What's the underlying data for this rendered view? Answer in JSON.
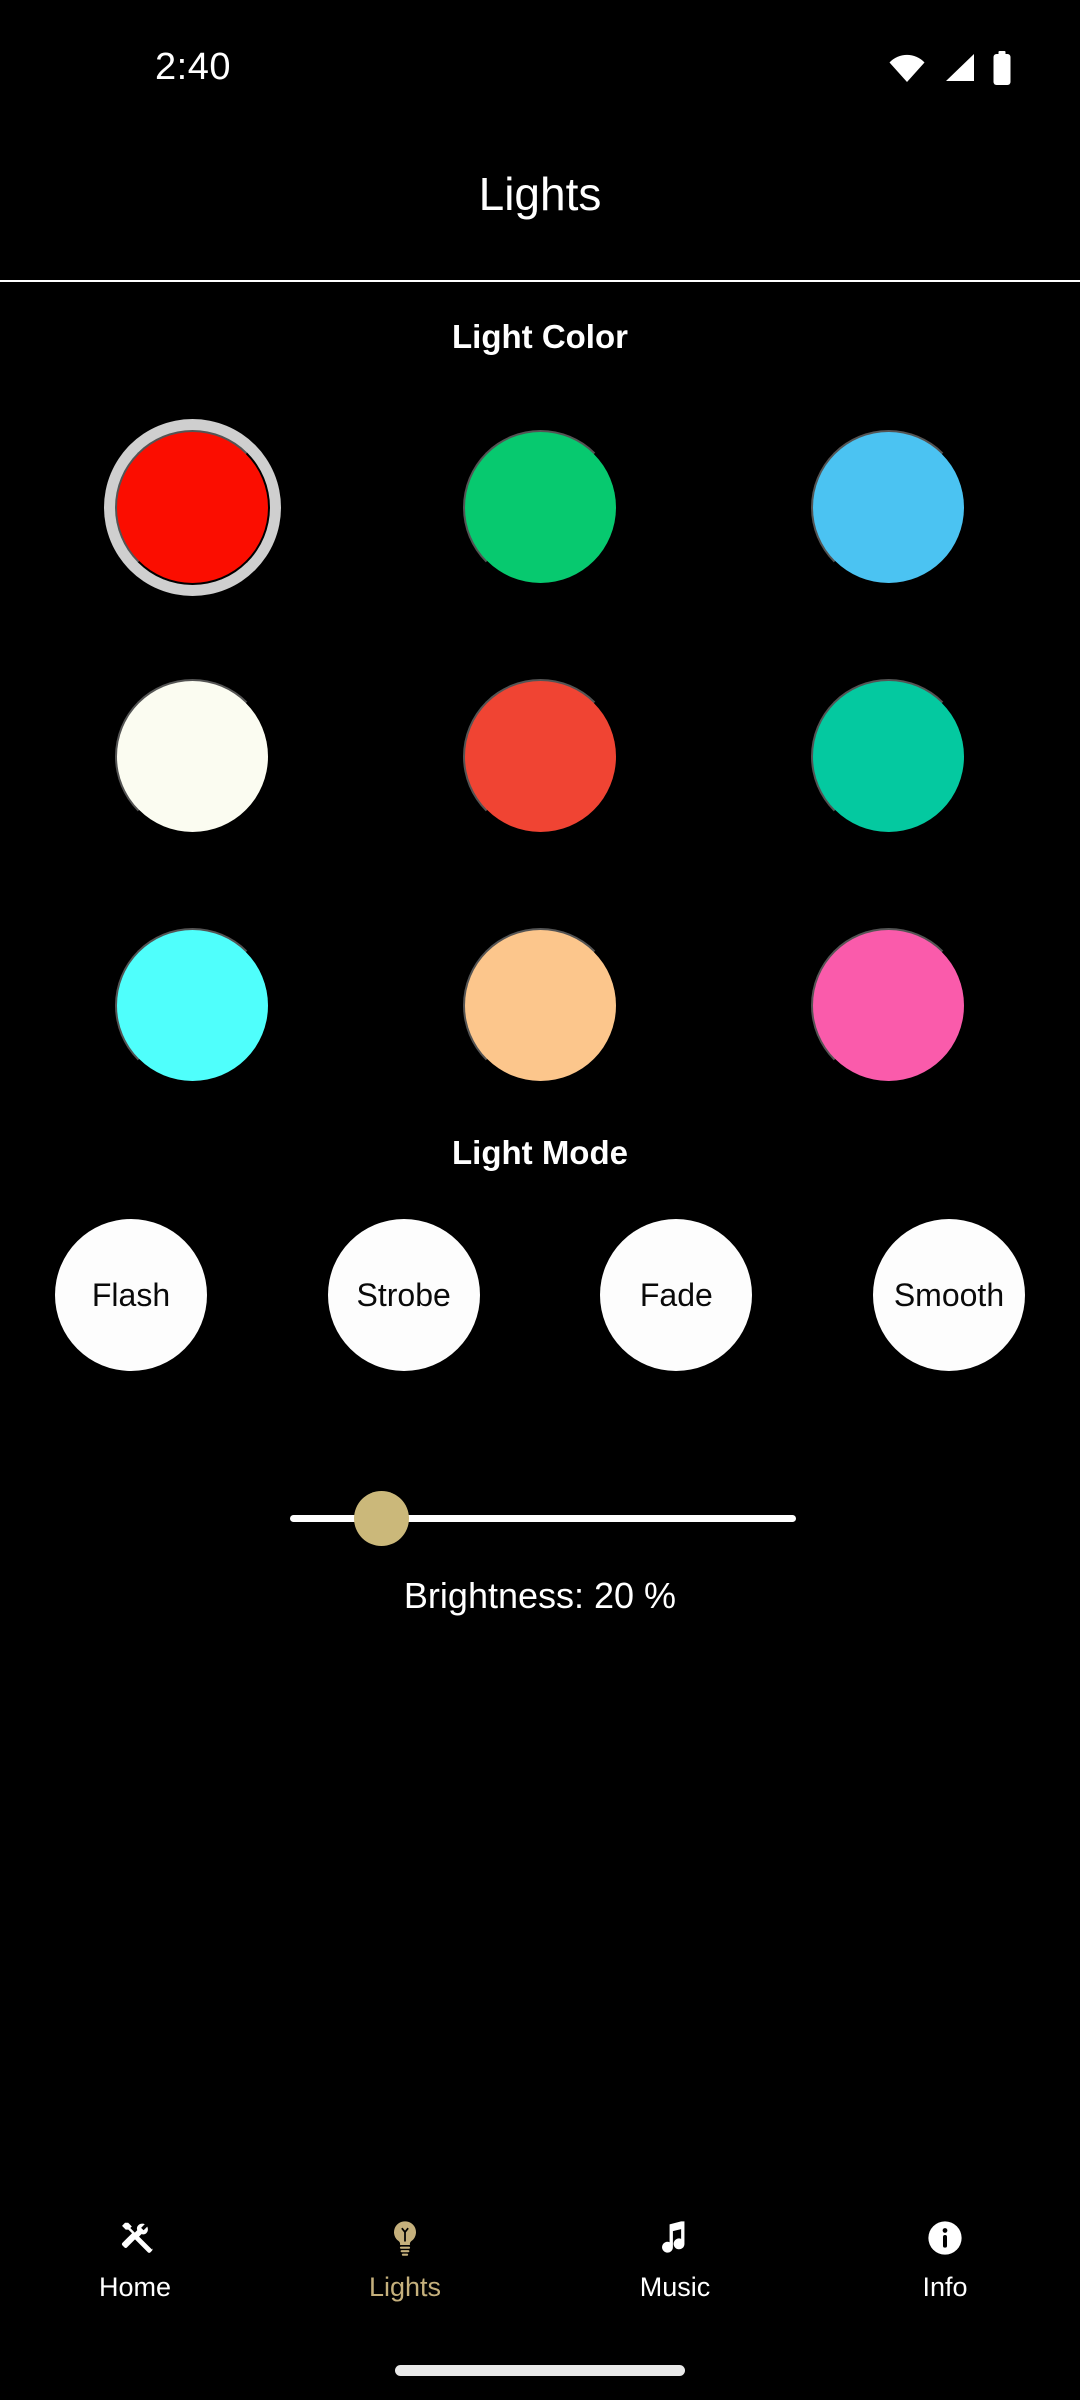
{
  "status_bar": {
    "time": "2:40",
    "icons": [
      "wifi-icon",
      "cellular-signal-icon",
      "battery-icon"
    ]
  },
  "app_bar": {
    "title": "Lights"
  },
  "sections": {
    "color_heading": "Light Color",
    "mode_heading": "Light Mode"
  },
  "colors": {
    "selection_ring": "#cfcfcf",
    "rows": [
      [
        {
          "name": "red",
          "hex": "#FB0D00",
          "selected": true
        },
        {
          "name": "green",
          "hex": "#07C96F",
          "selected": false
        },
        {
          "name": "blue",
          "hex": "#4BC3F2",
          "selected": false
        }
      ],
      [
        {
          "name": "ivory",
          "hex": "#FBFCF1",
          "selected": false
        },
        {
          "name": "coral",
          "hex": "#F04433",
          "selected": false
        },
        {
          "name": "teal",
          "hex": "#04C9A0",
          "selected": false
        }
      ],
      [
        {
          "name": "cyan",
          "hex": "#4FFFFC",
          "selected": false
        },
        {
          "name": "peach",
          "hex": "#FCC68C",
          "selected": false
        },
        {
          "name": "pink",
          "hex": "#FA5BAB",
          "selected": false
        }
      ]
    ]
  },
  "modes": [
    {
      "label": "Flash"
    },
    {
      "label": "Strobe"
    },
    {
      "label": "Fade"
    },
    {
      "label": "Smooth"
    }
  ],
  "brightness": {
    "label": "Brightness: 20 %",
    "value": 20,
    "min": 0,
    "max": 100,
    "thumb_color": "#cbb87a",
    "track_color": "#ffffff"
  },
  "bottom_nav": {
    "active_color": "#c5b07c",
    "inactive_color": "#ffffff",
    "items": [
      {
        "label": "Home",
        "icon": "tools-icon",
        "active": false
      },
      {
        "label": "Lights",
        "icon": "lightbulb-icon",
        "active": true
      },
      {
        "label": "Music",
        "icon": "music-note-icon",
        "active": false
      },
      {
        "label": "Info",
        "icon": "info-icon",
        "active": false
      }
    ]
  }
}
